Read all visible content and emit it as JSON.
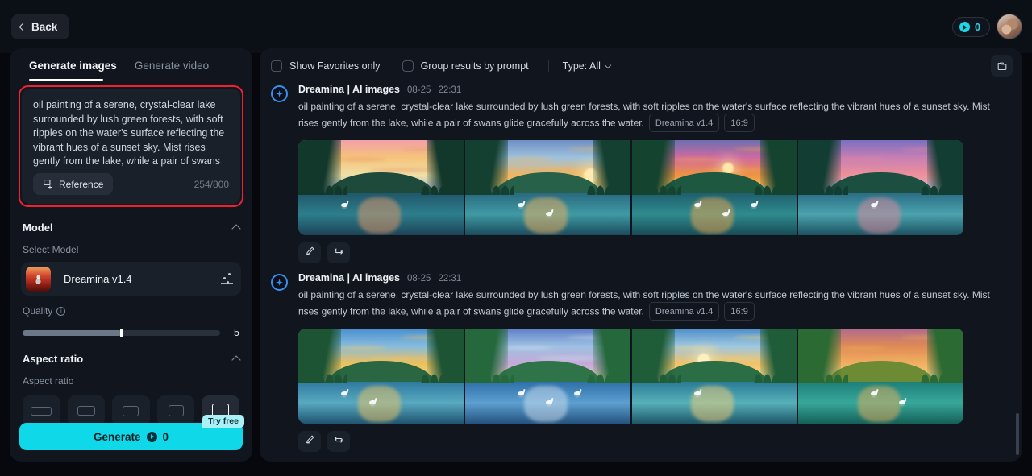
{
  "topbar": {
    "back_label": "Back",
    "credits_value": "0",
    "credit_icon": "credit-coin-icon",
    "avatar_icon": "user-avatar"
  },
  "left_panel": {
    "tabs": [
      {
        "label": "Generate images",
        "active": true
      },
      {
        "label": "Generate video",
        "active": false
      }
    ],
    "prompt": {
      "text": "oil painting of a serene, crystal-clear lake surrounded by lush green forests, with soft ripples on the water's surface reflecting the vibrant hues of a sunset sky. Mist rises gently from the lake, while a pair of swans glide gracefully across the water.",
      "reference_label": "Reference",
      "counter": "254/800",
      "highlight_color": "#f3212f"
    },
    "model": {
      "section_title": "Model",
      "sub_label": "Select Model",
      "selected": "Dreamina v1.4"
    },
    "quality": {
      "label": "Quality",
      "value": "5",
      "fill_percent": 50
    },
    "aspect_ratio": {
      "section_title": "Aspect ratio",
      "sub_label": "Aspect ratio",
      "options": [
        {
          "name": "ratio-21-9",
          "w": 26,
          "h": 11,
          "selected": false
        },
        {
          "name": "ratio-16-9",
          "w": 22,
          "h": 12,
          "selected": false
        },
        {
          "name": "ratio-3-2",
          "w": 20,
          "h": 13,
          "selected": false
        },
        {
          "name": "ratio-4-3",
          "w": 19,
          "h": 14,
          "selected": false
        },
        {
          "name": "ratio-1-1",
          "w": 21,
          "h": 19,
          "selected": true
        }
      ]
    },
    "generate": {
      "label": "Generate",
      "cost": "0",
      "badge": "Try free",
      "accent_color": "#0fd8e8"
    }
  },
  "right_panel": {
    "filters": {
      "favorites_label": "Show Favorites only",
      "favorites_checked": false,
      "group_label": "Group results by prompt",
      "group_checked": false,
      "type_label": "Type: All"
    },
    "folder_button_icon": "folder-icon",
    "results": [
      {
        "title": "Dreamina | AI images",
        "date": "08-25",
        "time": "22:31",
        "prompt": "oil painting of a serene, crystal-clear lake surrounded by lush green forests, with soft ripples on the water's surface reflecting the vibrant hues of a sunset sky. Mist rises gently from the lake, while a pair of swans glide gracefully across the water.",
        "tags": [
          "Dreamina v1.4",
          "16:9"
        ],
        "actions": [
          "edit-icon",
          "regenerate-icon"
        ],
        "images": [
          {
            "name": "lake-sunset-pink-sky"
          },
          {
            "name": "lake-sunset-golden-sun"
          },
          {
            "name": "lake-sunset-magenta-clouds"
          },
          {
            "name": "lake-dusk-violet-sky"
          }
        ]
      },
      {
        "title": "Dreamina | AI images",
        "date": "08-25",
        "time": "22:31",
        "prompt": "oil painting of a serene, crystal-clear lake surrounded by lush green forests, with soft ripples on the water's surface reflecting the vibrant hues of a sunset sky. Mist rises gently from the lake, while a pair of swans glide gracefully across the water.",
        "tags": [
          "Dreamina v1.4",
          "16:9"
        ],
        "actions": [
          "edit-icon",
          "regenerate-icon"
        ],
        "images": [
          {
            "name": "lake-dawn-amber-glow"
          },
          {
            "name": "lake-blue-morning-swans"
          },
          {
            "name": "lake-misty-sunrise-swan"
          },
          {
            "name": "lake-teal-hill-reflection"
          }
        ]
      }
    ]
  }
}
